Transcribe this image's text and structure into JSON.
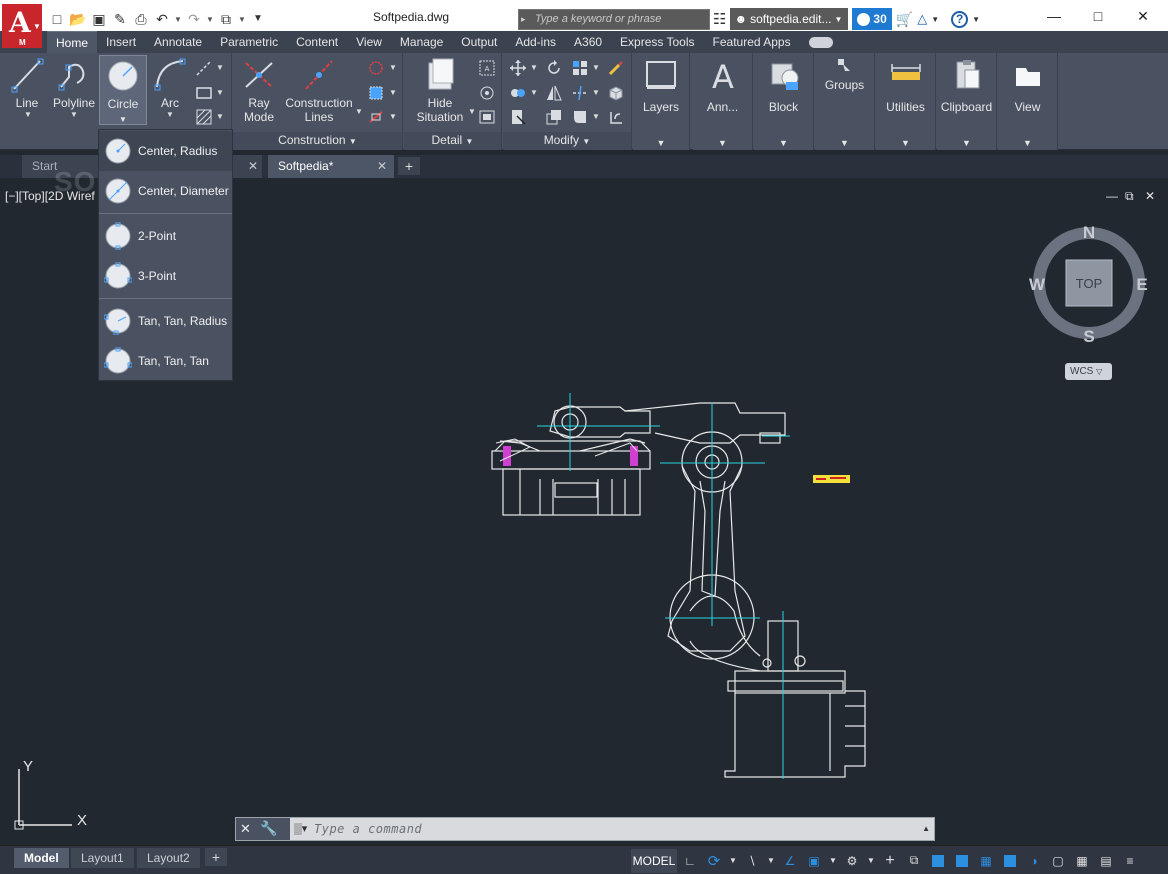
{
  "app": {
    "logo_letter": "A",
    "logo_sub": "M",
    "window_title": "Softpedia.dwg",
    "search_placeholder": "Type a keyword or phrase",
    "user_name": "softpedia.edit...",
    "trial_days": "30",
    "help": "?"
  },
  "ribbon_tabs": [
    "Home",
    "Insert",
    "Annotate",
    "Parametric",
    "Content",
    "View",
    "Manage",
    "Output",
    "Add-ins",
    "A360",
    "Express Tools",
    "Featured Apps"
  ],
  "ribbon": {
    "draw": {
      "line": "Line",
      "polyline": "Polyline",
      "circle": "Circle",
      "arc": "Arc"
    },
    "construction": {
      "ray_mode_1": "Ray",
      "ray_mode_2": "Mode",
      "construction_lines_1": "Construction",
      "construction_lines_2": "Lines",
      "title": "Construction"
    },
    "detail": {
      "hide_1": "Hide",
      "hide_2": "Situation",
      "title": "Detail"
    },
    "modify": {
      "title": "Modify"
    },
    "layers": "Layers",
    "annotation": "Ann...",
    "block": "Block",
    "groups": "Groups",
    "utilities": "Utilities",
    "clipboard": "Clipboard",
    "view": "View"
  },
  "circle_menu": [
    {
      "label": "Center, Radius"
    },
    {
      "label": "Center, Diameter"
    },
    {
      "label": "2-Point"
    },
    {
      "label": "3-Point"
    },
    {
      "label": "Tan, Tan, Radius"
    },
    {
      "label": "Tan, Tan, Tan"
    }
  ],
  "doc_tabs": {
    "start": "Start",
    "active": "Softpedia*"
  },
  "canvas": {
    "viewport_label": "[−][Top][2D Wiref",
    "watermark": "SOFTPEDIA",
    "viewcube": {
      "n": "N",
      "s": "S",
      "e": "E",
      "w": "W",
      "face": "TOP",
      "wcs": "WCS"
    },
    "ucs_x": "X",
    "ucs_y": "Y"
  },
  "command_line": {
    "placeholder": "Type a command"
  },
  "layout_tabs": [
    "Model",
    "Layout1",
    "Layout2"
  ],
  "status": {
    "model_label": "MODEL"
  },
  "colors": {
    "accent": "#1e7bd1",
    "drawing_bg": "#212830",
    "ribbon_bg": "#4a5262",
    "logo_red": "#c8262c"
  }
}
